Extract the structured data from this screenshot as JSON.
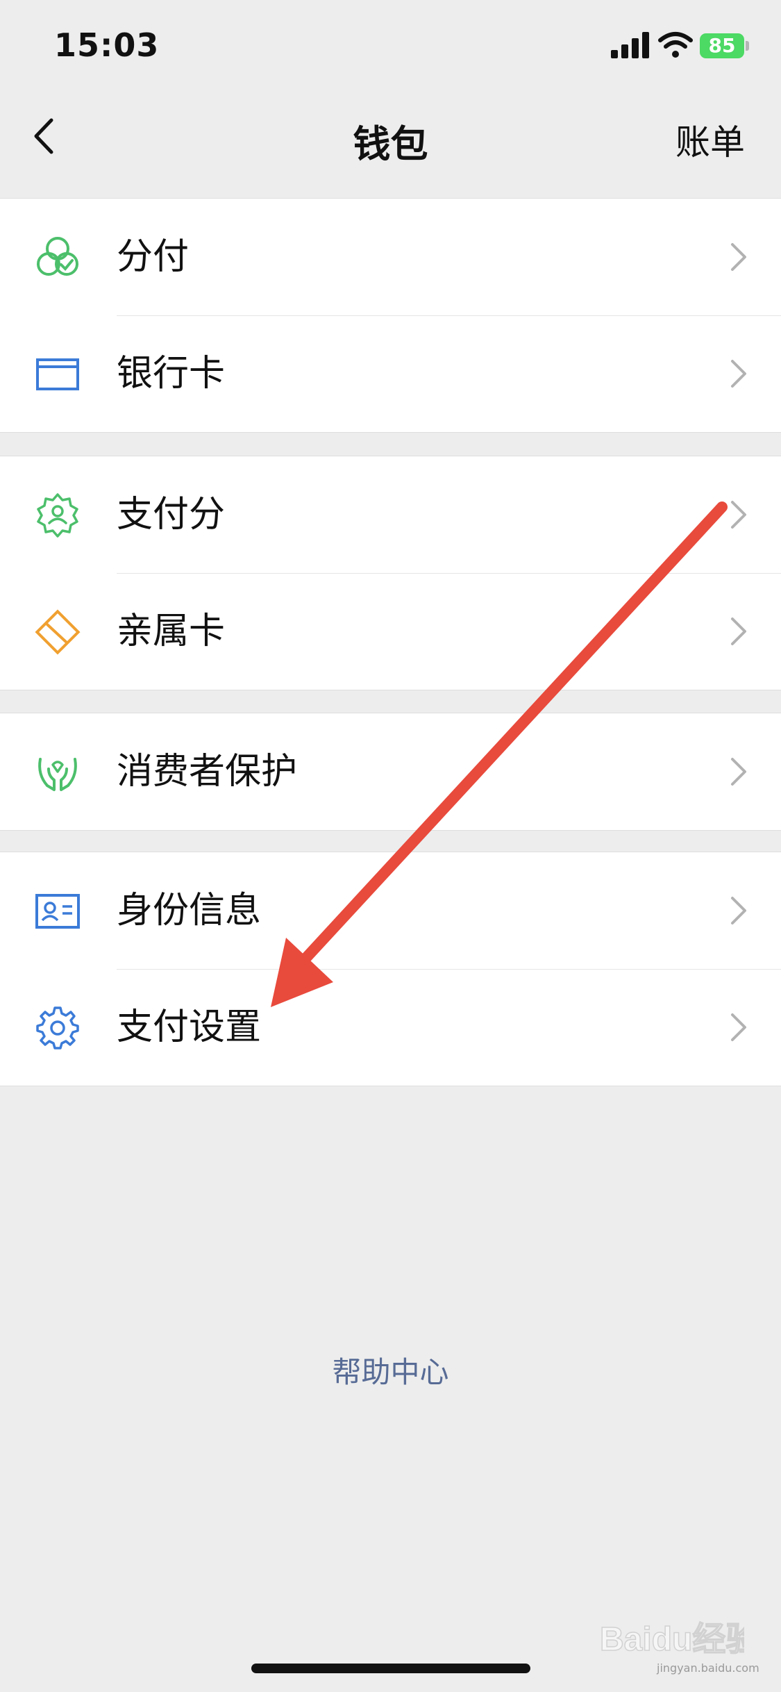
{
  "status_bar": {
    "time": "15:03",
    "battery": "85"
  },
  "nav": {
    "title": "钱包",
    "right_action": "账单"
  },
  "groups": [
    {
      "items": [
        {
          "label": "分付",
          "icon": "fenfu-icon",
          "color": "#4cbf6b"
        },
        {
          "label": "银行卡",
          "icon": "bank-card-icon",
          "color": "#3b7bd8"
        }
      ]
    },
    {
      "items": [
        {
          "label": "支付分",
          "icon": "payscore-icon",
          "color": "#4cbf6b"
        },
        {
          "label": "亲属卡",
          "icon": "family-card-icon",
          "color": "#f0a030"
        }
      ]
    },
    {
      "items": [
        {
          "label": "消费者保护",
          "icon": "consumer-protection-icon",
          "color": "#4cbf6b"
        }
      ]
    },
    {
      "items": [
        {
          "label": "身份信息",
          "icon": "id-card-icon",
          "color": "#3b7bd8"
        },
        {
          "label": "支付设置",
          "icon": "gear-icon",
          "color": "#3b7bd8"
        }
      ]
    }
  ],
  "footer": {
    "help": "帮助中心"
  },
  "colors": {
    "background": "#ededed",
    "link": "#576b95",
    "annotation_arrow": "#e84a3c",
    "battery": "#4cd964"
  },
  "watermark": {
    "logo": "Baidu经验",
    "url": "jingyan.baidu.com"
  }
}
